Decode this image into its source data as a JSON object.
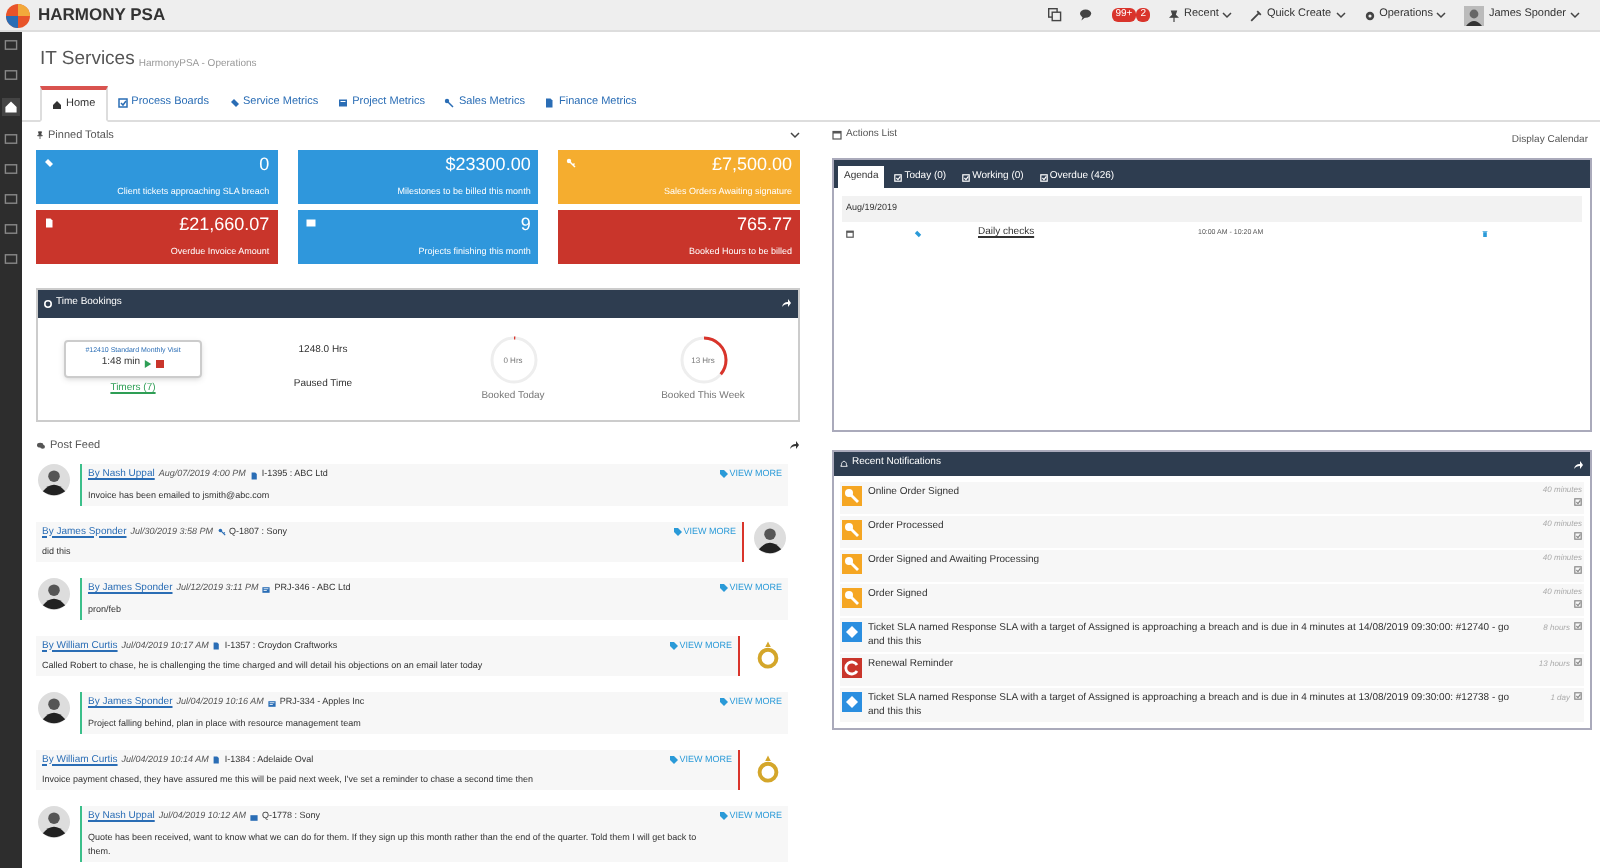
{
  "topbar": {
    "brand": "HARMONY PSA",
    "badges": [
      "99+",
      "2"
    ],
    "menus": [
      "Recent",
      "Quick Create",
      "Operations"
    ],
    "user": "James Sponder"
  },
  "sidebar": {
    "items": [
      {
        "selected": false
      },
      {
        "selected": false
      },
      {
        "selected": true
      },
      {
        "selected": false
      },
      {
        "selected": false
      },
      {
        "selected": false
      },
      {
        "selected": false
      },
      {
        "selected": false
      }
    ]
  },
  "header": {
    "title": "IT Services",
    "breadcrumb": "HarmonyPSA - Operations"
  },
  "tabs": [
    {
      "label": "Home",
      "selected": true
    },
    {
      "label": "Process Boards",
      "selected": false
    },
    {
      "label": "Service Metrics",
      "selected": false
    },
    {
      "label": "Project Metrics",
      "selected": false
    },
    {
      "label": "Sales Metrics",
      "selected": false
    },
    {
      "label": "Finance Metrics",
      "selected": false
    }
  ],
  "pinned_totals": {
    "title": "Pinned Totals",
    "cards": [
      {
        "value": "0",
        "label": "Client tickets approaching SLA breach",
        "color": "#2f97dc",
        "kind": "ticket"
      },
      {
        "value": "$23300.00",
        "label": "Milestones to be billed this month",
        "color": "#2f97dc"
      },
      {
        "value": "£7,500.00",
        "label": "Sales Orders Awaiting signature",
        "color": "#f5ad2f",
        "kind": "key"
      },
      {
        "value": "£21,660.07",
        "label": "Overdue Invoice Amount",
        "color": "#c9352b",
        "kind": "doc"
      },
      {
        "value": "9",
        "label": "Projects finishing this month",
        "color": "#2f97dc",
        "kind": "project"
      },
      {
        "value": "765.77",
        "label": "Booked Hours to be billed",
        "color": "#c9352b"
      }
    ]
  },
  "time_bookings": {
    "title": "Time Bookings",
    "timer": {
      "name": "#12410 Standard Monthly Visit",
      "elapsed": "1:48 min"
    },
    "timers_link": "Timers (7)",
    "paused": {
      "value": "1248.0 Hrs",
      "label": "Paused Time"
    },
    "rings": [
      {
        "value": "0 Hrs",
        "label": "Booked Today",
        "level": 0.01
      },
      {
        "value": "13 Hrs",
        "label": "Booked This Week",
        "level": 0.36
      }
    ]
  },
  "post_feed": {
    "title": "Post Feed",
    "posts": [
      {
        "kind": "left",
        "avatar": {
          "kind": "person"
        },
        "author": "By Nash Uppal",
        "time": "Aug/07/2019 4:00 PM",
        "ref": {
          "kind": "doc",
          "text": "I-1395 : ABC Ltd"
        },
        "text": "Invoice has been emailed to jsmith@abc.com",
        "link": "VIEW MORE"
      },
      {
        "kind": "right",
        "avatar": {
          "kind": "person"
        },
        "author": "By James Sponder",
        "time": "Jul/30/2019 3:58 PM",
        "ref": {
          "kind": "key",
          "text": "Q-1807 : Sony"
        },
        "text": "did this",
        "link": "VIEW MORE"
      },
      {
        "kind": "left",
        "avatar": {
          "kind": "person"
        },
        "author": "By James Sponder",
        "time": "Jul/12/2019 3:11 PM",
        "ref": {
          "kind": "project",
          "text": "PRJ-346 - ABC Ltd"
        },
        "text": "pron/feb",
        "link": "VIEW MORE"
      },
      {
        "kind": "right",
        "avatar": {
          "kind": "award"
        },
        "author": "By William Curtis",
        "time": "Jul/04/2019 10:17 AM",
        "ref": {
          "kind": "doc",
          "text": "I-1357 : Croydon Craftworks"
        },
        "text": "Called Robert to chase, he is challenging the time charged and will detail his objections on an email later today",
        "link": "VIEW MORE"
      },
      {
        "kind": "left",
        "avatar": {
          "kind": "person"
        },
        "author": "By James Sponder",
        "time": "Jul/04/2019 10:16 AM",
        "ref": {
          "kind": "project",
          "text": "PRJ-334 - Apples Inc"
        },
        "text": "Project falling behind, plan in place with resource management team",
        "link": "VIEW MORE"
      },
      {
        "kind": "right",
        "avatar": {
          "kind": "award"
        },
        "author": "By William Curtis",
        "time": "Jul/04/2019 10:14 AM",
        "ref": {
          "kind": "doc",
          "text": "I-1384 : Adelaide Oval"
        },
        "text": "Invoice payment chased, they have assured me this will be paid next week, I've set a reminder to chase a second time then",
        "link": "VIEW MORE"
      },
      {
        "kind": "left",
        "avatar": {
          "kind": "person"
        },
        "author": "By Nash Uppal",
        "time": "Jul/04/2019 10:12 AM",
        "ref": {
          "kind": "quote",
          "text": "Q-1778 : Sony"
        },
        "text": "Quote has been received, want to know what we can do for them. If they sign up this month rather than the end of the quarter. Told them I will get back to them.",
        "link": "VIEW MORE"
      }
    ]
  },
  "actions_list": {
    "title": "Actions List",
    "display_calendar": "Display Calendar",
    "tabs": [
      {
        "label": "Agenda",
        "selected": true
      },
      {
        "label": "Today (0)",
        "selected": false
      },
      {
        "label": "Working (0)",
        "selected": false
      },
      {
        "label": "Overdue (426)",
        "selected": false
      }
    ],
    "date": "Aug/19/2019",
    "entries": [
      {
        "title": "Daily checks",
        "time": "10:00 AM - 10:20 AM"
      }
    ]
  },
  "notifications": {
    "title": "Recent Notifications",
    "items": [
      {
        "kind": "order",
        "text": "Online Order Signed",
        "time": "40 minutes"
      },
      {
        "kind": "order",
        "text": "Order Processed",
        "time": "40 minutes"
      },
      {
        "kind": "order",
        "text": "Order Signed and Awaiting Processing",
        "time": "40 minutes"
      },
      {
        "kind": "order",
        "text": "Order Signed",
        "time": "40 minutes"
      },
      {
        "kind": "ticket",
        "text": "Ticket SLA named Response SLA with a target of Assigned is approaching a breach and is due in 4 minutes at 14/08/2019 09:30:00: #12740 - go and this this",
        "time": "8 hours"
      },
      {
        "kind": "renewal",
        "text": "Renewal Reminder",
        "time": "13 hours"
      },
      {
        "kind": "ticket",
        "text": "Ticket SLA named Response SLA with a target of Assigned is approaching a breach and is due in 4 minutes at 13/08/2019 09:30:00: #12738 - go and this this",
        "time": "1 day"
      }
    ]
  }
}
